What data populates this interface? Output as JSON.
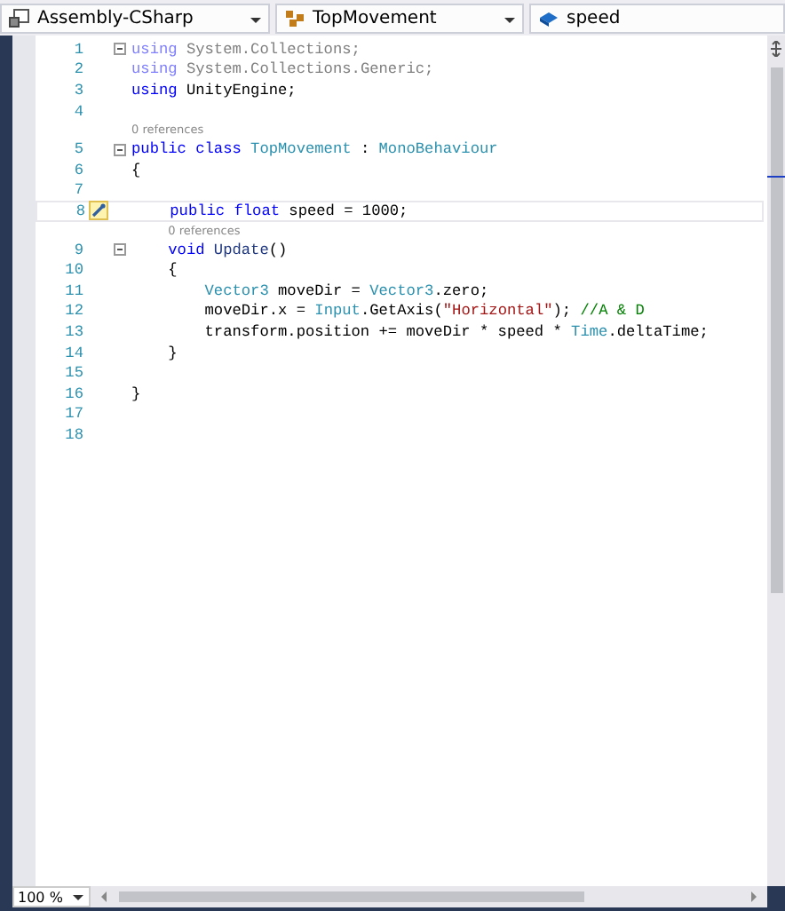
{
  "navigation_bar": {
    "project": "Assembly-CSharp",
    "type": "TopMovement",
    "member": "speed"
  },
  "lines": [
    {
      "number": "1",
      "current": false,
      "fold": true,
      "tokens": [
        {
          "text": "using",
          "kind": "keyword-faded"
        },
        {
          "text": " System.Collections;",
          "kind": "faded"
        }
      ]
    },
    {
      "number": "2",
      "current": false,
      "fold": false,
      "tokens": [
        {
          "text": "using",
          "kind": "keyword-faded"
        },
        {
          "text": " System.Collections.Generic;",
          "kind": "faded"
        }
      ]
    },
    {
      "number": "3",
      "current": false,
      "fold": false,
      "tokens": [
        {
          "text": "using",
          "kind": "keyword"
        },
        {
          "text": " UnityEngine;",
          "kind": "plain"
        }
      ]
    },
    {
      "number": "4",
      "current": false,
      "fold": false
    },
    {
      "number": "5",
      "current": false,
      "fold": true,
      "lens": "0 references",
      "tokens": [
        {
          "text": "public class ",
          "kind": "keyword"
        },
        {
          "text": "TopMovement",
          "kind": "type"
        },
        {
          "text": " : ",
          "kind": "plain"
        },
        {
          "text": "MonoBehaviour",
          "kind": "type"
        }
      ]
    },
    {
      "number": "6",
      "current": false,
      "fold": false,
      "tokens": [
        {
          "text": "{",
          "kind": "plain"
        }
      ]
    },
    {
      "number": "7",
      "current": false,
      "fold": false
    },
    {
      "number": "8",
      "current": true,
      "fold": false,
      "tokens": [
        {
          "text": "    public float",
          "kind": "keyword"
        },
        {
          "text": " speed = 1000;",
          "kind": "plain"
        }
      ]
    },
    {
      "number": "9",
      "current": false,
      "fold": true,
      "lens": "0 references",
      "tokens": [
        {
          "text": "    void ",
          "kind": "keyword"
        },
        {
          "text": "Update",
          "kind": "method"
        },
        {
          "text": "()",
          "kind": "plain"
        }
      ]
    },
    {
      "number": "10",
      "current": false,
      "fold": false,
      "tokens": [
        {
          "text": "    {",
          "kind": "plain"
        }
      ]
    },
    {
      "number": "11",
      "current": false,
      "fold": false,
      "tokens": [
        {
          "text": "        Vector3",
          "kind": "type"
        },
        {
          "text": " moveDir = ",
          "kind": "plain"
        },
        {
          "text": "Vector3",
          "kind": "type"
        },
        {
          "text": ".zero;",
          "kind": "plain"
        }
      ]
    },
    {
      "number": "12",
      "current": false,
      "fold": false,
      "tokens": [
        {
          "text": "        moveDir.x = ",
          "kind": "plain"
        },
        {
          "text": "Input",
          "kind": "type"
        },
        {
          "text": ".GetAxis(",
          "kind": "plain"
        },
        {
          "text": "\"Horizontal\"",
          "kind": "string"
        },
        {
          "text": "); ",
          "kind": "plain"
        },
        {
          "text": "//A & D",
          "kind": "comment"
        }
      ]
    },
    {
      "number": "13",
      "current": false,
      "fold": false,
      "tokens": [
        {
          "text": "        transform.position += moveDir * speed * ",
          "kind": "plain"
        },
        {
          "text": "Time",
          "kind": "type"
        },
        {
          "text": ".deltaTime;",
          "kind": "plain"
        }
      ]
    },
    {
      "number": "14",
      "current": false,
      "fold": false,
      "tokens": [
        {
          "text": "    }",
          "kind": "plain"
        }
      ]
    },
    {
      "number": "15",
      "current": false,
      "fold": false
    },
    {
      "number": "16",
      "current": false,
      "fold": false,
      "tokens": [
        {
          "text": "}",
          "kind": "plain"
        }
      ]
    },
    {
      "number": "17",
      "current": false,
      "fold": false
    },
    {
      "number": "18",
      "current": false,
      "fold": false
    }
  ],
  "zoom": "100 %"
}
